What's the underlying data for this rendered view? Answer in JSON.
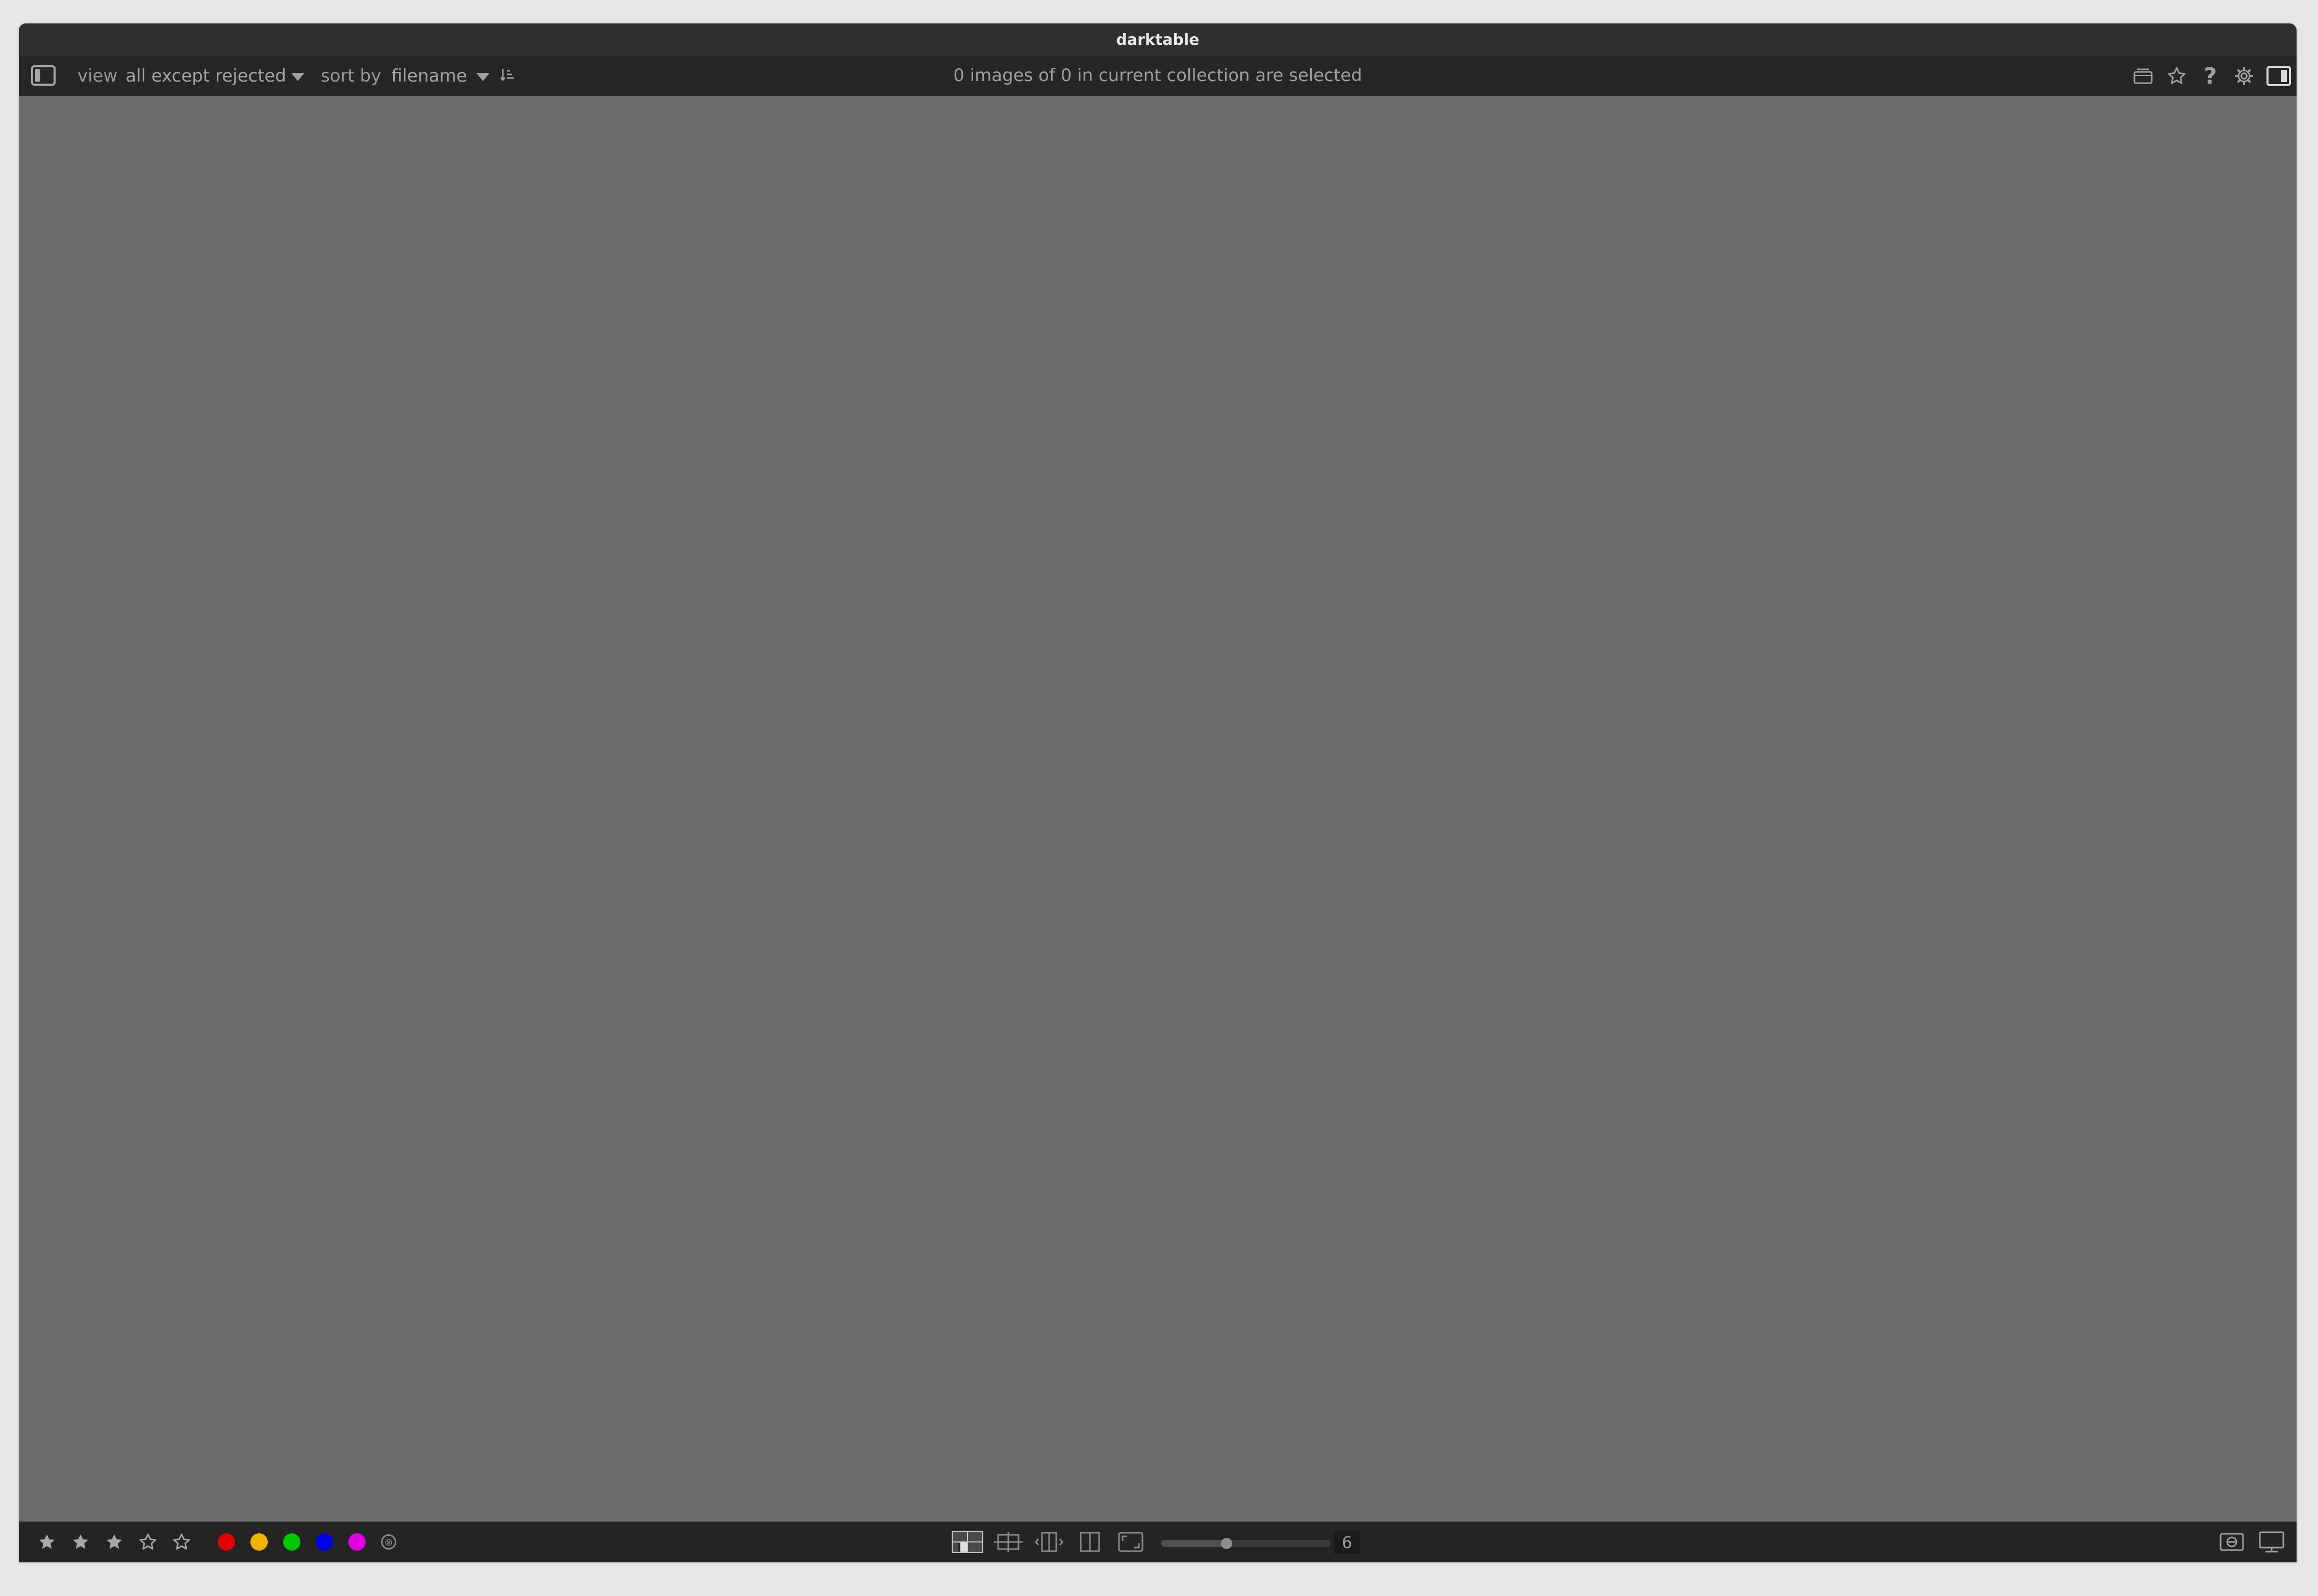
{
  "window": {
    "title": "darktable"
  },
  "topbar": {
    "left_panel_icon": "left-panel-toggle-icon",
    "view_label": "view",
    "view_value": "all except rejected",
    "sort_label": "sort by",
    "sort_value": "filename",
    "sort_direction_icon": "sort-ascending-icon",
    "status": "0 images of 0 in current collection are selected",
    "right_icons": [
      "grouping-icon",
      "star-overlay-icon",
      "help-icon",
      "preferences-gear-icon",
      "right-panel-toggle-icon"
    ]
  },
  "bottombar": {
    "rating_icons": [
      "star-filled-icon",
      "star-filled-icon",
      "star-filled-icon",
      "star-outline-icon",
      "star-outline-icon"
    ],
    "color_labels": [
      {
        "name": "red",
        "color": "#e00000"
      },
      {
        "name": "yellow",
        "color": "#f0b400"
      },
      {
        "name": "green",
        "color": "#00c800"
      },
      {
        "name": "blue",
        "color": "#0000e6"
      },
      {
        "name": "purple",
        "color": "#e000e0"
      }
    ],
    "clear_color_symbol": "⊗",
    "layout_icons": [
      "filemanager-layout-icon",
      "zoomable-lighttable-icon",
      "culling-fixed-icon",
      "culling-dynamic-icon",
      "full-preview-icon"
    ],
    "thumbs_per_row": "6",
    "right_icons": [
      "focus-peaking-icon",
      "display-profile-icon"
    ]
  },
  "colors": {
    "bg_main": "#6b6b6b",
    "bar": "#262626",
    "icon": "#a0a0a0"
  }
}
